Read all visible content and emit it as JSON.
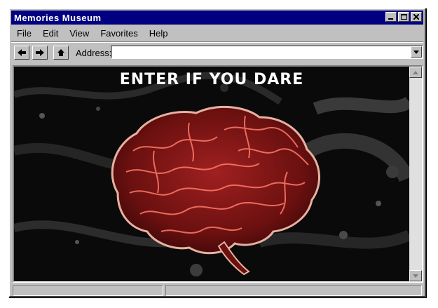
{
  "window": {
    "title": "Memories  Museum"
  },
  "menu": [
    "File",
    "Edit",
    "View",
    "Favorites",
    "Help"
  ],
  "toolbar": {
    "address_label": "Address:",
    "address_value": ""
  },
  "page": {
    "headline": "ENTER IF YOU DARE"
  },
  "colors": {
    "titlebar": "#000080",
    "chrome": "#c0c0c0",
    "brain": "#8b1a1a"
  }
}
